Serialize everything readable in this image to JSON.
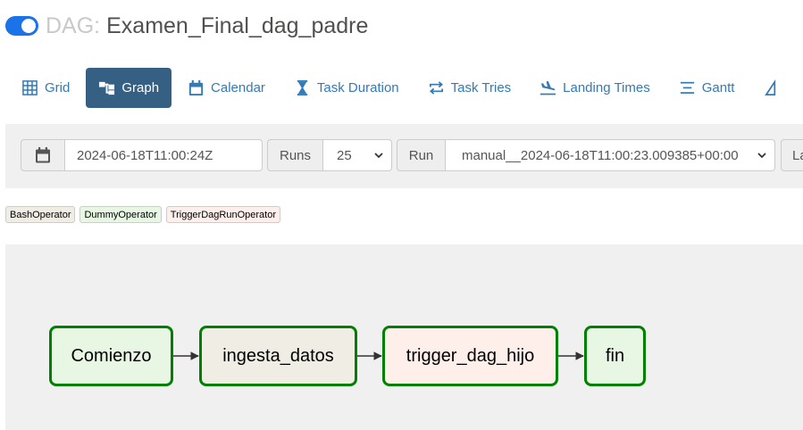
{
  "header": {
    "prefix": "DAG:",
    "dag_name": "Examen_Final_dag_padre",
    "toggle_on": true,
    "toggle_color": "#1a73e8"
  },
  "nav": {
    "active_color": "#365f84",
    "link_color": "#337ab7",
    "tabs": [
      {
        "label": "Grid",
        "icon": "grid-icon",
        "active": false
      },
      {
        "label": "Graph",
        "icon": "graph-icon",
        "active": true
      },
      {
        "label": "Calendar",
        "icon": "calendar-icon",
        "active": false
      },
      {
        "label": "Task Duration",
        "icon": "hourglass-icon",
        "active": false
      },
      {
        "label": "Task Tries",
        "icon": "retry-icon",
        "active": false
      },
      {
        "label": "Landing Times",
        "icon": "plane-landing-icon",
        "active": false
      },
      {
        "label": "Gantt",
        "icon": "gantt-icon",
        "active": false
      }
    ]
  },
  "filters": {
    "base_date": "2024-06-18T11:00:24Z",
    "runs_label": "Runs",
    "runs_value": "25",
    "run_label": "Run",
    "run_value": "manual__2024-06-18T11:00:23.009385+00:00",
    "layout_label_partial": "La"
  },
  "legend": [
    {
      "label": "BashOperator",
      "color": "#f0ede4"
    },
    {
      "label": "DummyOperator",
      "color": "#e8f7e4"
    },
    {
      "label": "TriggerDagRunOperator",
      "color": "#ffefeb"
    }
  ],
  "graph": {
    "border_color": "#008000",
    "nodes": [
      {
        "id": "Comienzo",
        "label": "Comienzo",
        "operator": "DummyOperator",
        "color": "#e8f7e4"
      },
      {
        "id": "ingesta_datos",
        "label": "ingesta_datos",
        "operator": "BashOperator",
        "color": "#f0ede4"
      },
      {
        "id": "trigger_dag_hijo",
        "label": "trigger_dag_hijo",
        "operator": "TriggerDagRunOperator",
        "color": "#ffefeb"
      },
      {
        "id": "fin",
        "label": "fin",
        "operator": "DummyOperator",
        "color": "#e8f7e4"
      }
    ],
    "edges": [
      [
        "Comienzo",
        "ingesta_datos"
      ],
      [
        "ingesta_datos",
        "trigger_dag_hijo"
      ],
      [
        "trigger_dag_hijo",
        "fin"
      ]
    ]
  }
}
